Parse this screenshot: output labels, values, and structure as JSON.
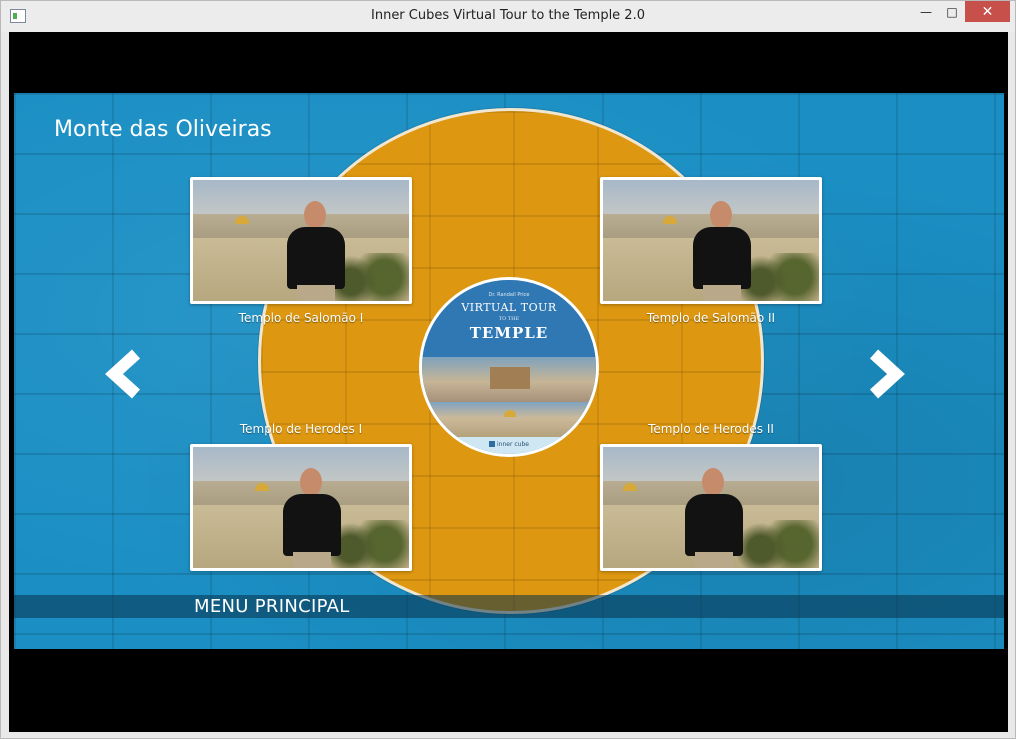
{
  "window": {
    "title": "Inner Cubes Virtual Tour to the Temple 2.0",
    "controls": {
      "minimize": "—",
      "maximize": "□",
      "close": "✕"
    }
  },
  "stage": {
    "title": "Monte das Oliveiras",
    "colors": {
      "background": "#1b8fc4",
      "circle": "#dd9710"
    }
  },
  "videos": [
    {
      "label": "Templo de Salomão I"
    },
    {
      "label": "Templo de Salomão II"
    },
    {
      "label": "Templo de Herodes I"
    },
    {
      "label": "Templo de Herodes II"
    }
  ],
  "center_logo": {
    "author": "Dr. Randall Price",
    "line1": "VIRTUAL TOUR",
    "line2": "TO THE",
    "line3": "TEMPLE",
    "brand": "inner cube"
  },
  "nav": {
    "prev_icon": "chevron-left-icon",
    "next_icon": "chevron-right-icon"
  },
  "menu": {
    "label": "MENU PRINCIPAL"
  }
}
